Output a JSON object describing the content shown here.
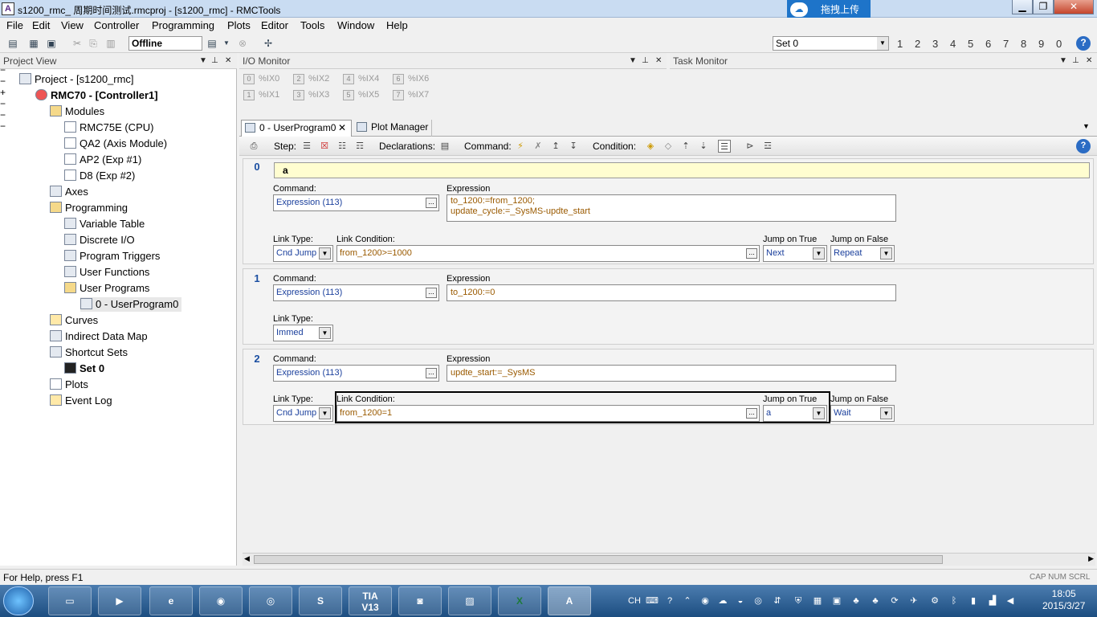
{
  "window": {
    "title": "s1200_rmc_ 周期时间测试.rmcproj - [s1200_rmc] - RMCTools",
    "app_icon": "rmctools-icon",
    "controls": [
      "minimize",
      "maximize",
      "close"
    ]
  },
  "upload_button": "拖拽上传",
  "menu": [
    "File",
    "Edit",
    "View",
    "Controller",
    "Programming",
    "Plots",
    "Editor",
    "Tools",
    "Window",
    "Help"
  ],
  "toolbar": {
    "mode": "Offline",
    "shortcut_set": "Set 0",
    "set_numbers": [
      "1",
      "2",
      "3",
      "4",
      "5",
      "6",
      "7",
      "8",
      "9",
      "0"
    ]
  },
  "project_view": {
    "title": "Project View",
    "tree": [
      {
        "label": "Project - [s1200_rmc]",
        "level": 0,
        "icon": "project-icon",
        "expanded": true
      },
      {
        "label": "RMC70 - [Controller1]",
        "level": 1,
        "icon": "controller-icon",
        "expanded": true,
        "bold": true
      },
      {
        "label": "Modules",
        "level": 2,
        "icon": "folder-icon",
        "expanded": true
      },
      {
        "label": "RMC75E (CPU)",
        "level": 3,
        "icon": "module-icon"
      },
      {
        "label": "QA2 (Axis Module)",
        "level": 3,
        "icon": "module-icon"
      },
      {
        "label": "AP2 (Exp #1)",
        "level": 3,
        "icon": "module-icon"
      },
      {
        "label": "D8 (Exp #2)",
        "level": 3,
        "icon": "module-icon"
      },
      {
        "label": "Axes",
        "level": 2,
        "icon": "axes-icon",
        "expanded": false
      },
      {
        "label": "Programming",
        "level": 2,
        "icon": "folder-icon",
        "expanded": true
      },
      {
        "label": "Variable Table",
        "level": 3,
        "icon": "table-icon"
      },
      {
        "label": "Discrete I/O",
        "level": 3,
        "icon": "io-icon"
      },
      {
        "label": "Program Triggers",
        "level": 3,
        "icon": "trigger-icon"
      },
      {
        "label": "User Functions",
        "level": 3,
        "icon": "function-icon"
      },
      {
        "label": "User Programs",
        "level": 3,
        "icon": "folder-icon",
        "expanded": true
      },
      {
        "label": "0 - UserProgram0",
        "level": 4,
        "icon": "program-icon",
        "selected": true
      },
      {
        "label": "Curves",
        "level": 2,
        "icon": "curve-icon"
      },
      {
        "label": "Indirect Data Map",
        "level": 2,
        "icon": "map-icon"
      },
      {
        "label": "Shortcut Sets",
        "level": 2,
        "icon": "shortcut-icon",
        "expanded": true
      },
      {
        "label": "Set 0",
        "level": 3,
        "icon": "set-icon",
        "bold": true
      },
      {
        "label": "Plots",
        "level": 2,
        "icon": "plot-icon"
      },
      {
        "label": "Event Log",
        "level": 2,
        "icon": "log-icon"
      }
    ]
  },
  "io_monitor": {
    "title": "I/O Monitor",
    "inputs": [
      {
        "num": "0",
        "name": "%IX0"
      },
      {
        "num": "2",
        "name": "%IX2"
      },
      {
        "num": "4",
        "name": "%IX4"
      },
      {
        "num": "6",
        "name": "%IX6"
      },
      {
        "num": "1",
        "name": "%IX1"
      },
      {
        "num": "3",
        "name": "%IX3"
      },
      {
        "num": "5",
        "name": "%IX5"
      },
      {
        "num": "7",
        "name": "%IX7"
      }
    ]
  },
  "task_monitor": {
    "title": "Task Monitor"
  },
  "tabs": [
    {
      "label": "0 - UserProgram0",
      "active": true
    },
    {
      "label": "Plot Manager",
      "active": false
    }
  ],
  "editor_toolbar": {
    "step": "Step:",
    "declarations": "Declarations:",
    "command": "Command:",
    "condition": "Condition:"
  },
  "labels": {
    "command": "Command:",
    "expression": "Expression",
    "link_type": "Link Type:",
    "link_condition": "Link Condition:",
    "jump_true": "Jump on True",
    "jump_false": "Jump on False"
  },
  "steps": [
    {
      "num": "0",
      "label": "a",
      "command": "Expression (113)",
      "expression": [
        "to_1200:=from_1200;",
        "update_cycle:=_SysMS-updte_start"
      ],
      "link_type": "Cnd Jump",
      "link_condition": "from_1200>=1000",
      "jump_true": "Next",
      "jump_false": "Repeat"
    },
    {
      "num": "1",
      "command": "Expression (113)",
      "expression": [
        "to_1200:=0"
      ],
      "link_type": "Immed"
    },
    {
      "num": "2",
      "command": "Expression (113)",
      "expression": [
        "updte_start:=_SysMS"
      ],
      "link_type": "Cnd Jump",
      "link_condition": "from_1200=1",
      "jump_true": "a",
      "jump_false": "Wait"
    }
  ],
  "status": "For Help, press F1",
  "status_right": "CAP NUM SCRL",
  "taskbar": {
    "apps": [
      "explorer",
      "media",
      "ie",
      "weibo",
      "chrome",
      "sogou",
      "TIA V13",
      "camera",
      "photos",
      "excel",
      "rmctools"
    ],
    "tia_label": "TIA\nV13",
    "tray_lang": "CH",
    "time": "18:05",
    "date": "2015/3/27"
  }
}
